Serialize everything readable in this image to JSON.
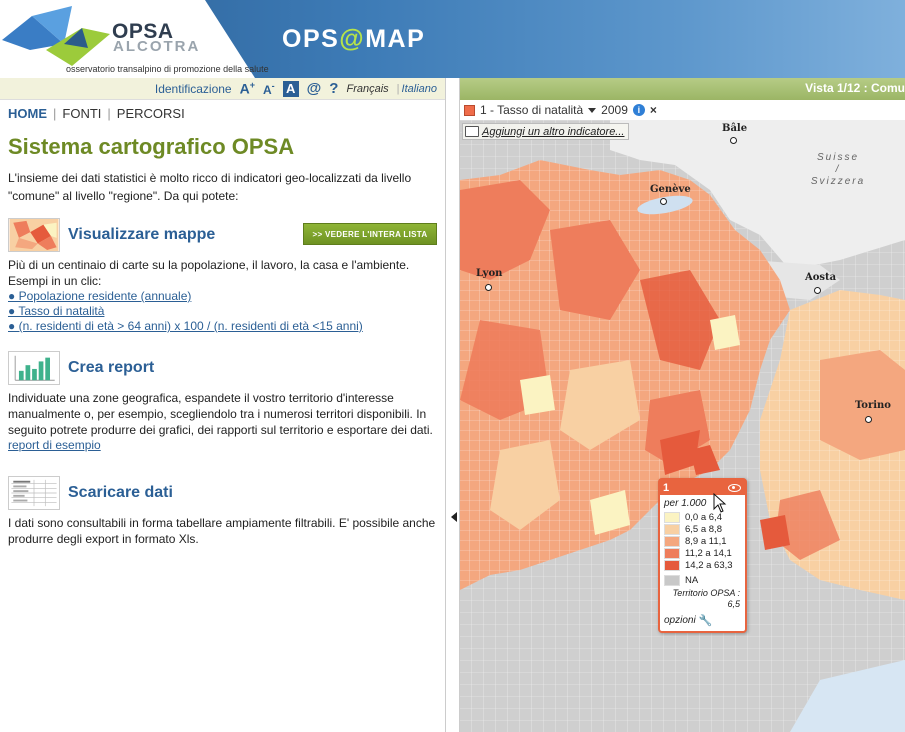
{
  "header": {
    "logo_title": "OPSA",
    "logo_subtitle": "ALCOTRA",
    "logo_tagline": "osservatorio transalpino di promozione della salute",
    "app_name_pre": "OPS",
    "app_name_at": "@",
    "app_name_post": "MAP"
  },
  "toolbar": {
    "identification": "Identificazione",
    "text_bigger": "A",
    "text_bigger_sign": "+",
    "text_smaller": "A",
    "text_smaller_sign": "-",
    "contrast": "A",
    "contact_icon": "@",
    "help_icon": "?",
    "lang_fr": "Français",
    "lang_sep": "|",
    "lang_it": "Italiano"
  },
  "nav": {
    "home": "HOME",
    "sep": "|",
    "fonti": "FONTI",
    "percorsi": "PERCORSI"
  },
  "main": {
    "title": "Sistema cartografico OPSA",
    "intro": "L'insieme dei dati statistici è molto ricco di indicatori geo-localizzati da livello \"comune\" al livello \"regione\". Da qui potete:",
    "sections": [
      {
        "title": "Visualizzare mappe",
        "button": ">> vedere l'intera lista",
        "text": "Più di un centinaio di carte su la popolazione, il lavoro, la casa e l'ambiente. Esempi in un clic:",
        "links": [
          "● Popolazione residente (annuale)",
          "● Tasso di natalità",
          "● (n. residenti di età > 64 anni) x 100 / (n. residenti di età <15 anni)"
        ]
      },
      {
        "title": "Crea report",
        "text": "Individuate una zone geografica, espandete il vostro territorio d'interesse manualmente o, per esempio, scegliendolo tra i numerosi territori disponibili. In seguito potrete produrre dei grafici, dei rapporti sul territorio e esportare dei dati.",
        "links": [
          "report di esempio"
        ]
      },
      {
        "title": "Scaricare dati",
        "text": "I dati sono consultabili in forma tabellare ampiamente filtrabili. E' possibile anche produrre degli export in formato Xls."
      }
    ]
  },
  "map": {
    "vista": "Vista 1/12 : Comu",
    "indicator_label": "1 - Tasso di natalità",
    "indicator_year": "2009",
    "info_icon": "i",
    "close_icon": "×",
    "add_indicator": "Aggiungi un altro indicatore...",
    "cities": {
      "bale": "Bâle",
      "geneve": "Genève",
      "lyon": "Lyon",
      "aosta": "Aosta",
      "torino": "Torino"
    },
    "country_1": "Suisse",
    "country_sep": "/",
    "country_2": "Svizzera",
    "legend": {
      "number": "1",
      "unit": "per 1.000",
      "classes": [
        {
          "label": "0,0 a 6,4",
          "color": "#fbf3c2"
        },
        {
          "label": "6,5 a 8,8",
          "color": "#f8d0a3"
        },
        {
          "label": "8,9 a 11,1",
          "color": "#f4a77f"
        },
        {
          "label": "11,2 a 14,1",
          "color": "#ee7d5c"
        },
        {
          "label": "14,2 a 63,3",
          "color": "#e55a3c"
        }
      ],
      "na_label": "NA",
      "na_color": "#c8c8c8",
      "territory_label": "Territorio OPSA :",
      "territory_value": "6,5",
      "options": "opzioni"
    }
  }
}
